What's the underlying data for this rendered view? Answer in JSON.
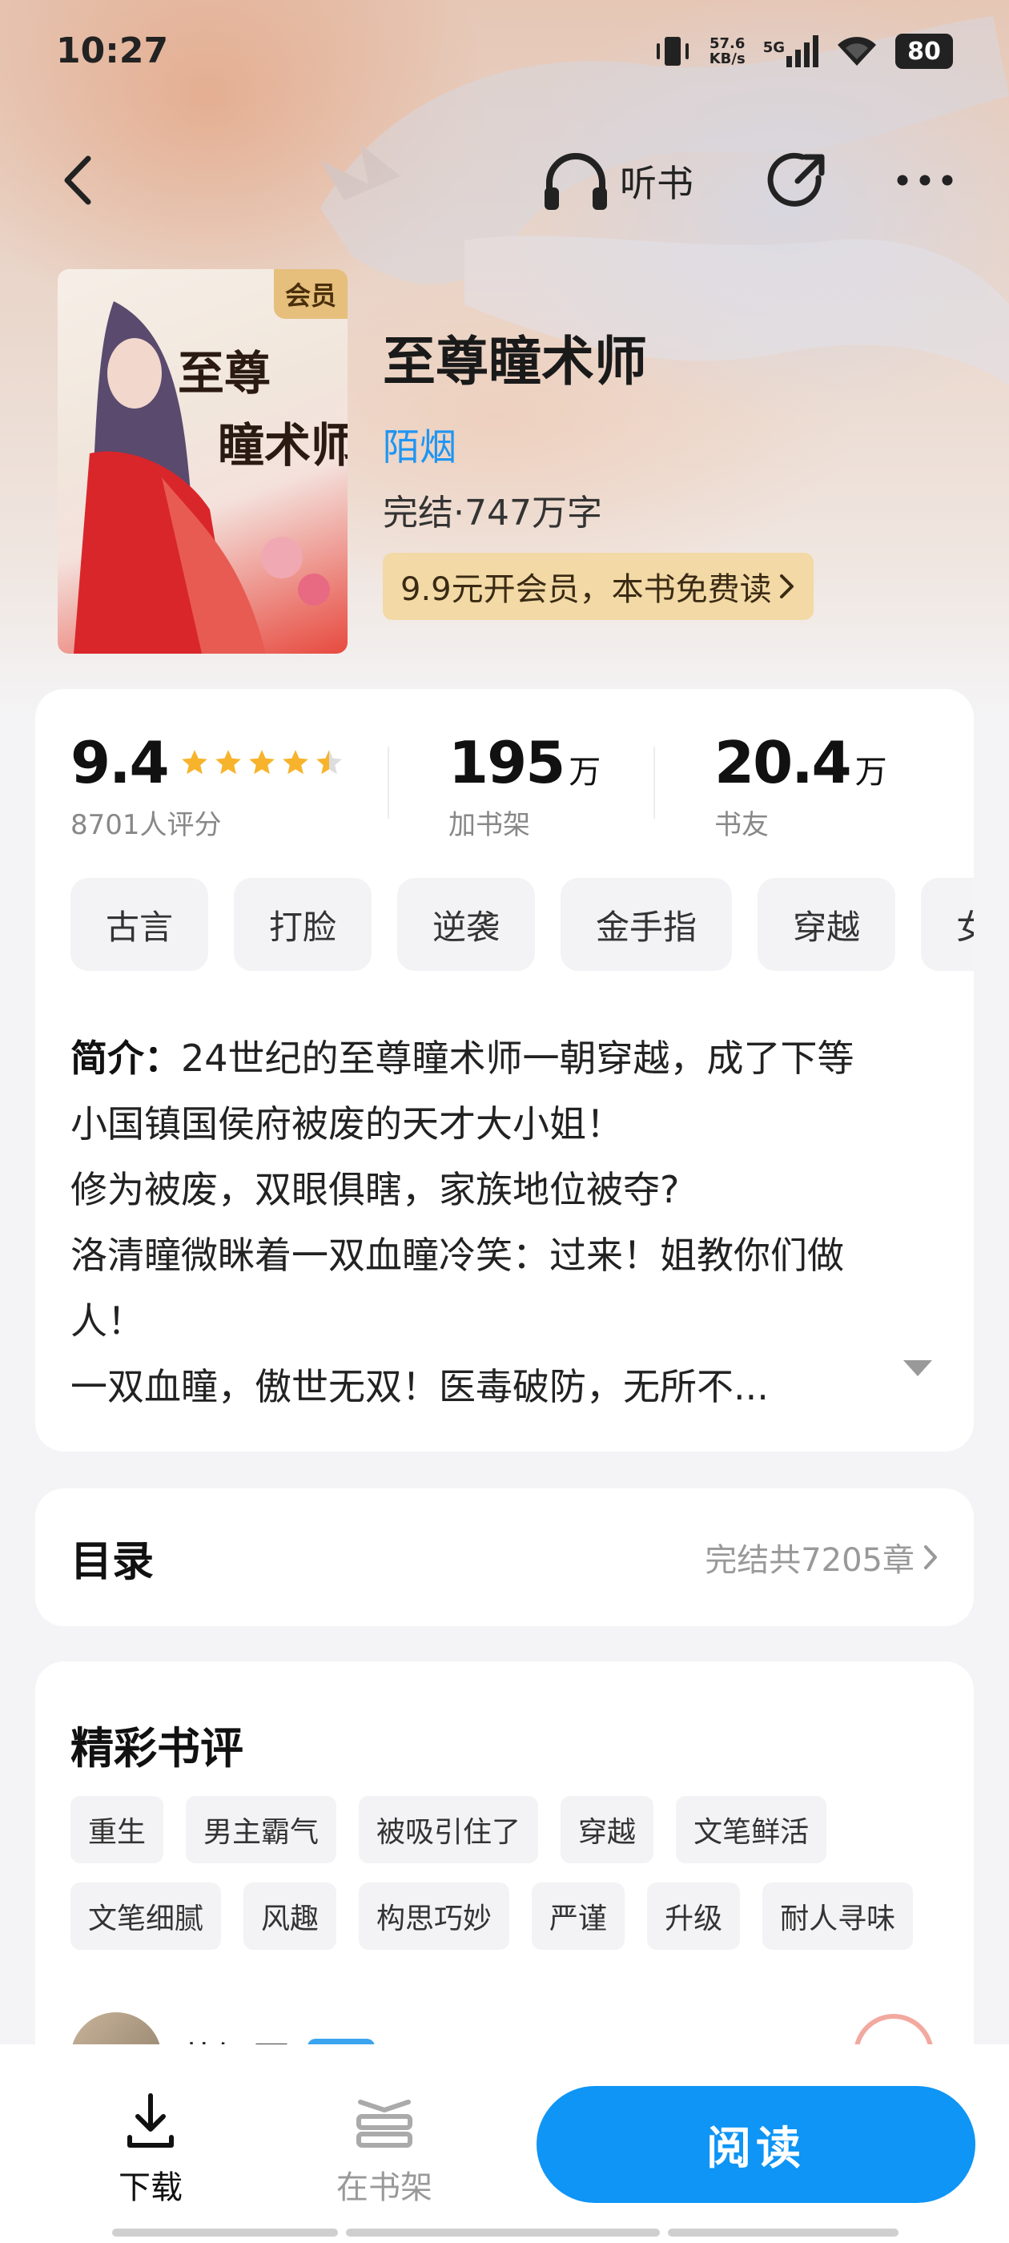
{
  "status_bar": {
    "time": "10:27",
    "net_speed_value": "57.6",
    "net_speed_unit": "KB/s",
    "network": "5G",
    "battery": "80"
  },
  "nav": {
    "back_icon": "chevron-left-icon",
    "listen_label": "听书",
    "listen_icon": "headphones-icon",
    "share_icon": "share-icon",
    "more_icon": "more-horizontal-icon"
  },
  "book": {
    "cover_badge": "会员",
    "title": "至尊瞳术师",
    "author": "陌烟",
    "meta": "完结·747万字",
    "vip_promo": "9.9元开会员，本书免费读"
  },
  "stats": {
    "rating": "9.4",
    "rating_stars": 4.5,
    "rating_count": "8701人评分",
    "shelf_value": "195",
    "shelf_unit": "万",
    "shelf_label": "加书架",
    "fans_value": "20.4",
    "fans_unit": "万",
    "fans_label": "书友"
  },
  "tags": [
    "古言",
    "打脸",
    "逆袭",
    "金手指",
    "穿越",
    "女"
  ],
  "intro": {
    "label": "简介：",
    "lines": [
      "24世纪的至尊瞳术师一朝穿越，成了下等",
      "小国镇国侯府被废的天才大小姐！",
      "修为被废，双眼俱瞎，家族地位被夺?",
      "洛清瞳微眯着一双血瞳冷笑：过来！姐教你们做",
      "人！",
      "一双血瞳，傲世无双！医毒破防，无所不..."
    ]
  },
  "toc": {
    "title": "目录",
    "meta": "完结共7205章"
  },
  "reviews": {
    "title": "精彩书评",
    "tags": [
      "重生",
      "男主霸气",
      "被吸引住了",
      "穿越",
      "文笔鲜活",
      "文笔细腻",
      "风趣",
      "构思巧妙",
      "严谨",
      "升级",
      "耐人寻味"
    ],
    "first_reviewer": "蔚知夏",
    "first_badge": "九级"
  },
  "bottom_bar": {
    "download_label": "下载",
    "shelf_label": "在书架",
    "read_label": "阅读"
  },
  "colors": {
    "accent": "#0e95f5",
    "author_link": "#1e95f3",
    "vip_gold": "#f2d9a5",
    "star": "#f7b32b"
  }
}
